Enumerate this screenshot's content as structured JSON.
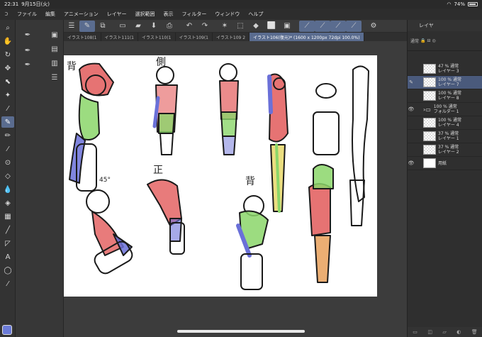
{
  "status": {
    "time": "22:31",
    "date": "9月15日(火)",
    "battery": "74%"
  },
  "menu": [
    "ファイル",
    "編集",
    "アニメーション",
    "レイヤー",
    "選択範囲",
    "表示",
    "フィルター",
    "ウィンドウ",
    "ヘルプ"
  ],
  "tabs": [
    {
      "label": "イラスト108(1",
      "active": false
    },
    {
      "label": "イラスト111(1",
      "active": false
    },
    {
      "label": "イラスト110(1",
      "active": false
    },
    {
      "label": "イラスト109(1",
      "active": false
    },
    {
      "label": "イラスト109 2",
      "active": false
    },
    {
      "label": "イラスト106(復元)* (1600 x 1200px 72dpi 100.0%)",
      "active": true
    }
  ],
  "right_panel": {
    "title": "レイヤ",
    "blend": "通常",
    "layers": [
      {
        "opacity": "47 %",
        "mode": "通常",
        "name": "レイヤー 3",
        "visible": false,
        "selected": false
      },
      {
        "opacity": "100 %",
        "mode": "通常",
        "name": "レイヤー 7",
        "visible": false,
        "selected": true
      },
      {
        "opacity": "100 %",
        "mode": "通常",
        "name": "レイヤー 8",
        "visible": false,
        "selected": false
      },
      {
        "opacity": "100 %",
        "mode": "通常",
        "name": "フォルダー 1",
        "visible": true,
        "selected": false
      },
      {
        "opacity": "100 %",
        "mode": "通常",
        "name": "レイヤー 4",
        "visible": false,
        "selected": false
      },
      {
        "opacity": "37 %",
        "mode": "通常",
        "name": "レイヤー 1",
        "visible": false,
        "selected": false
      },
      {
        "opacity": "37 %",
        "mode": "通常",
        "name": "レイヤー 2",
        "visible": false,
        "selected": false
      },
      {
        "opacity": "",
        "mode": "",
        "name": "用紙",
        "visible": true,
        "selected": false
      }
    ]
  },
  "canvas_labels": {
    "side": "側",
    "back": "背",
    "front": "正",
    "angle45": "45°",
    "back2": "背"
  },
  "colors": {
    "accent": "#5a6c8f",
    "main_color": "#6b7bd8",
    "red_fill": "#e25a5a",
    "green_fill": "#8bd66a",
    "blue_fill": "#6a70d8",
    "yellow_fill": "#e8d86a",
    "orange_fill": "#e8a05a"
  }
}
